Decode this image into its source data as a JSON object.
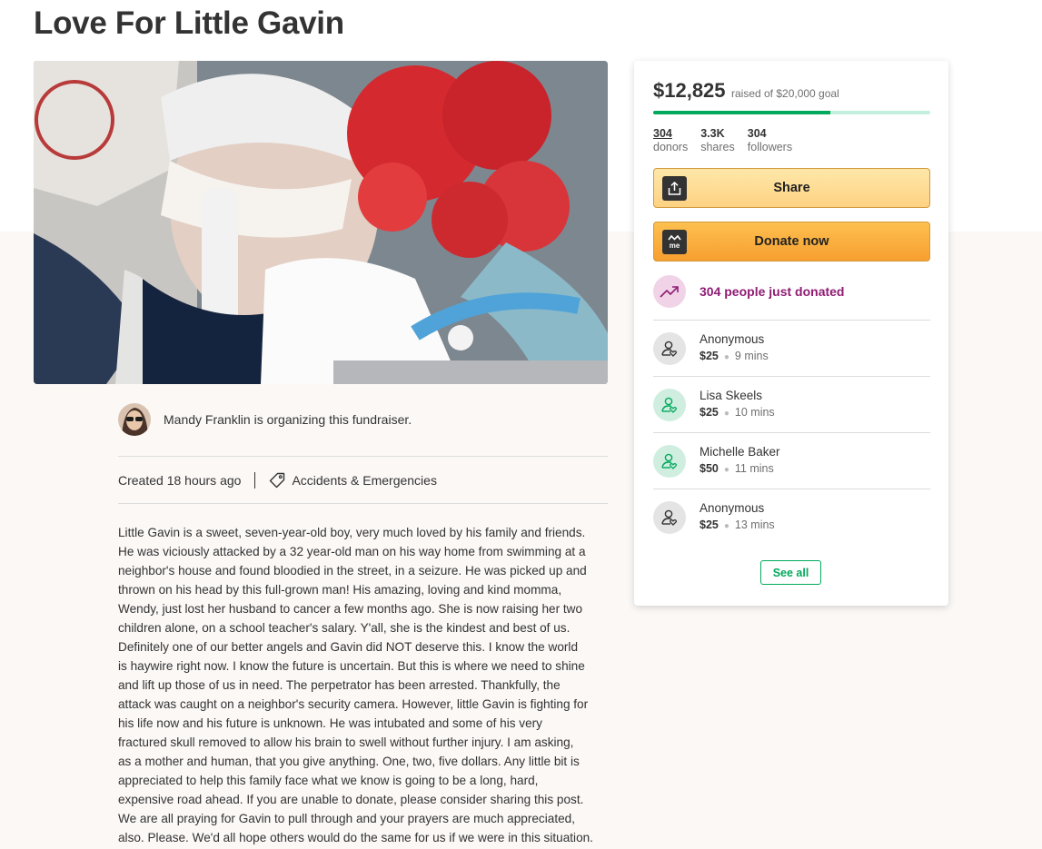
{
  "page_title": "Love For Little Gavin",
  "organizer": {
    "text": "Mandy Franklin is organizing this fundraiser."
  },
  "meta": {
    "created": "Created 18 hours ago",
    "category": "Accidents & Emergencies"
  },
  "story": "Little Gavin is a sweet, seven-year-old boy, very much loved by his family and friends.\n He was viciously attacked by a 32 year-old man on his way home from swimming at a\nneighbor's house and found bloodied in the street, in a seizure.  He was picked up and\nthrown on his head by this full-grown man! His amazing, loving and kind momma,\nWendy, just lost her husband to cancer a few months ago.  She is now raising her two\nchildren alone, on a school teacher's salary.  Y'all, she is the kindest and best of us.\n Definitely one of our better angels and Gavin did NOT deserve this.  I know the world\nis haywire right now.  I know the future is uncertain.  But this is where we need to shine\nand lift up those of us in need.  The perpetrator has been arrested.  Thankfully, the\nattack was caught on a neighbor's security camera.  However, little Gavin is fighting for\nhis life now and his future is unknown.  He was intubated and some of his very\nfractured skull removed to allow his brain to swell without further injury.  I am asking,\nas a mother and human, that you give anything.  One, two, five dollars.  Any little bit is\nappreciated to help this family face what we know is going to be a long, hard,\nexpensive road ahead.  If you are unable to donate, please consider sharing this post.\nWe are all praying for Gavin to pull through and your prayers are much appreciated,\nalso.  Please.  We'd all hope others would do the same for us if we were in this situation.",
  "donation_card": {
    "raised": "$12,825",
    "goal_text": "raised of $20,000 goal",
    "progress_fraction": 0.64,
    "stats": [
      {
        "value": "304",
        "label": "donors"
      },
      {
        "value": "3.3K",
        "label": "shares"
      },
      {
        "value": "304",
        "label": "followers"
      }
    ],
    "share_label": "Share",
    "donate_label": "Donate now",
    "just_donated": "304 people just donated",
    "donations": [
      {
        "name": "Anonymous",
        "amount": "$25",
        "time": "9 mins",
        "avatar": "gray"
      },
      {
        "name": "Lisa Skeels",
        "amount": "$25",
        "time": "10 mins",
        "avatar": "green"
      },
      {
        "name": "Michelle Baker",
        "amount": "$50",
        "time": "11 mins",
        "avatar": "green"
      },
      {
        "name": "Anonymous",
        "amount": "$25",
        "time": "13 mins",
        "avatar": "gray"
      }
    ],
    "see_all_label": "See all"
  },
  "colors": {
    "brand_green": "#02a95c",
    "donate_orange": "#f79f30",
    "share_yellow": "#fdd283",
    "trend_purple": "#8f1c73"
  },
  "icons": [
    "share-icon",
    "gofundme-logo-icon",
    "trending-up-icon",
    "donor-heart-icon",
    "tag-icon"
  ]
}
